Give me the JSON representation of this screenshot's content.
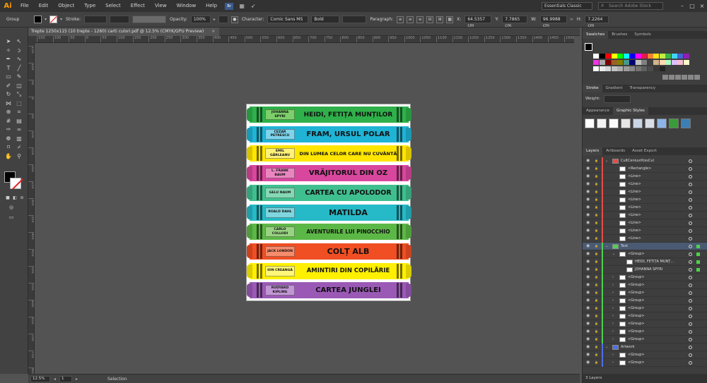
{
  "app": {
    "logo": "Ai",
    "workspace": "Essentials Classic",
    "search_placeholder": "Search Adobe Stock"
  },
  "menu": [
    "File",
    "Edit",
    "Object",
    "Type",
    "Select",
    "Effect",
    "View",
    "Window",
    "Help"
  ],
  "bridge_label": "Br",
  "control": {
    "selection": "Group",
    "stroke_label": "Stroke:",
    "opacity_label": "Opacity:",
    "opacity_value": "100%",
    "character_label": "Character:",
    "font_family": "Comic Sans MS",
    "font_style": "Bold",
    "paragraph_label": "Paragraph:",
    "x_label": "X:",
    "x_value": "64.5357 cm",
    "y_label": "Y:",
    "y_value": "7.7865 cm",
    "w_label": "W:",
    "w_value": "96.9988 cm",
    "h_label": "H:",
    "h_value": "7.2264 cm"
  },
  "document_tab": "Treptе 1250x115 (10 trepte - 1260) carti culori.pdf @ 12.5% (CMYK/GPU Preview)",
  "ruler_h": [
    "150",
    "100",
    "50",
    "0",
    "50",
    "100",
    "150",
    "200",
    "250",
    "300",
    "350",
    "400",
    "450",
    "500",
    "550",
    "600",
    "650",
    "700",
    "750",
    "800",
    "850",
    "900",
    "950",
    "1000",
    "1050",
    "1100",
    "1150",
    "1200",
    "1250",
    "1300",
    "1350",
    "1400",
    "1450",
    "1500"
  ],
  "ruler_v": [
    "150",
    "100",
    "50",
    "0",
    "50",
    "100",
    "150",
    "200",
    "250",
    "300",
    "350",
    "400",
    "450",
    "500",
    "550",
    "600",
    "650",
    "700",
    "750",
    "800"
  ],
  "crayons": [
    {
      "author": "JOHANNA SPYRI",
      "title": "HEIDI, FETIȚA MUNȚILOR",
      "color": "#2fb04a",
      "label": "#7ccf6a",
      "fs": 9
    },
    {
      "author": "CEZAR PETRESCU",
      "title": "FRAM, URSUL POLAR",
      "color": "#1fb3d6",
      "label": "#7fd3ea",
      "fs": 10
    },
    {
      "author": "EMIL GÂRLEANU",
      "title": "DIN LUMEA CELOR CARE NU CUVÂNTĂ",
      "color": "#ffe500",
      "label": "#fff17a",
      "fs": 6.5
    },
    {
      "author": "L. FRANK BAUM",
      "title": "VRĂJITORUL DIN OZ",
      "color": "#d8479d",
      "label": "#e986c0",
      "fs": 10
    },
    {
      "author": "GELU NAUM",
      "title": "CARTEA CU APOLODOR",
      "color": "#3fbf8f",
      "label": "#85d8b4",
      "fs": 9.5
    },
    {
      "author": "ROALD DAHL",
      "title": "MATILDA",
      "color": "#26b9c7",
      "label": "#80d6de",
      "fs": 11
    },
    {
      "author": "CARLO COLLODI",
      "title": "AVENTURILE LUI PINOCCHIO",
      "color": "#5cb846",
      "label": "#98d382",
      "fs": 7.5
    },
    {
      "author": "JACK LONDON",
      "title": "COLȚ ALB",
      "color": "#f04e23",
      "label": "#f58c6c",
      "fs": 11
    },
    {
      "author": "ION CREANGĂ",
      "title": "AMINTIRI DIN COPILĂRIE",
      "color": "#fff000",
      "label": "#fff77a",
      "fs": 8.5
    },
    {
      "author": "RUDYARD KIPLING",
      "title": "CARTEA JUNGLEI",
      "color": "#9b59b6",
      "label": "#c196d4",
      "fs": 10
    }
  ],
  "panels": {
    "swatches_tabs": [
      "Swatches",
      "Brushes",
      "Symbols"
    ],
    "stroke_tabs": [
      "Stroke",
      "Gradient",
      "Transparency"
    ],
    "weight_label": "Weight:",
    "appearance_tabs": [
      "Appearance",
      "Graphic Styles"
    ],
    "layers_tabs": [
      "Layers",
      "Artboards",
      "Asset Export"
    ],
    "layers_footer": "3 Layers"
  },
  "swatch_colors": [
    "#ffffff",
    "#000000",
    "#ff0000",
    "#ffff00",
    "#00ff00",
    "#00ffff",
    "#0000ff",
    "#ff00ff",
    "#e6194b",
    "#f58231",
    "#ffe119",
    "#bfef45",
    "#3cb44b",
    "#42d4f4",
    "#4363d8",
    "#911eb4",
    "#f032e6",
    "#a9a9a9",
    "#800000",
    "#9a6324",
    "#808000",
    "#469990",
    "#000075",
    "#c0c0c0",
    "#808080",
    "#404040",
    "#d2b48c",
    "#ffd8b1",
    "#aaffc3",
    "#dcbeff",
    "#fabed4",
    "#fffac8"
  ],
  "layers": [
    {
      "indent": 0,
      "label": "CultCeniusrKissCul",
      "bar": "#e84a4a",
      "exp": "v",
      "thumb": true
    },
    {
      "indent": 1,
      "label": "<Rectangle>",
      "bar": "#e84a4a"
    },
    {
      "indent": 1,
      "label": "<Line>",
      "bar": "#e84a4a"
    },
    {
      "indent": 1,
      "label": "<Line>",
      "bar": "#e84a4a"
    },
    {
      "indent": 1,
      "label": "<Line>",
      "bar": "#e84a4a"
    },
    {
      "indent": 1,
      "label": "<Line>",
      "bar": "#e84a4a"
    },
    {
      "indent": 1,
      "label": "<Line>",
      "bar": "#e84a4a"
    },
    {
      "indent": 1,
      "label": "<Line>",
      "bar": "#e84a4a"
    },
    {
      "indent": 1,
      "label": "<Line>",
      "bar": "#e84a4a"
    },
    {
      "indent": 1,
      "label": "<Line>",
      "bar": "#e84a4a"
    },
    {
      "indent": 1,
      "label": "<Line>",
      "bar": "#e84a4a"
    },
    {
      "indent": 0,
      "label": "Text",
      "bar": "#4fd14f",
      "exp": "v",
      "thumb": true,
      "active": true
    },
    {
      "indent": 1,
      "label": "<Group>",
      "bar": "#4fd14f",
      "exp": "v"
    },
    {
      "indent": 2,
      "label": "HEIDI, FETIȚA MUNȚ...",
      "bar": "#4fd14f"
    },
    {
      "indent": 2,
      "label": "JOHANNA SPYRI",
      "bar": "#4fd14f"
    },
    {
      "indent": 1,
      "label": "<Group>",
      "bar": "#4fd14f",
      "exp": ">"
    },
    {
      "indent": 1,
      "label": "<Group>",
      "bar": "#4fd14f",
      "exp": ">"
    },
    {
      "indent": 1,
      "label": "<Group>",
      "bar": "#4fd14f",
      "exp": ">"
    },
    {
      "indent": 1,
      "label": "<Group>",
      "bar": "#4fd14f",
      "exp": ">"
    },
    {
      "indent": 1,
      "label": "<Group>",
      "bar": "#4fd14f",
      "exp": ">"
    },
    {
      "indent": 1,
      "label": "<Group>",
      "bar": "#4fd14f",
      "exp": ">"
    },
    {
      "indent": 1,
      "label": "<Group>",
      "bar": "#4fd14f",
      "exp": ">"
    },
    {
      "indent": 1,
      "label": "<Group>",
      "bar": "#4fd14f",
      "exp": ">"
    },
    {
      "indent": 1,
      "label": "<Group>",
      "bar": "#4fd14f",
      "exp": ">"
    },
    {
      "indent": 0,
      "label": "Artwork",
      "bar": "#4f6fe8",
      "exp": "v",
      "thumb": true
    },
    {
      "indent": 1,
      "label": "<Group>",
      "bar": "#4f6fe8",
      "exp": ">"
    },
    {
      "indent": 1,
      "label": "<Group>",
      "bar": "#4f6fe8",
      "exp": ">"
    }
  ],
  "status": {
    "zoom": "12.5%",
    "artboard": "1",
    "tool": "Selection"
  }
}
